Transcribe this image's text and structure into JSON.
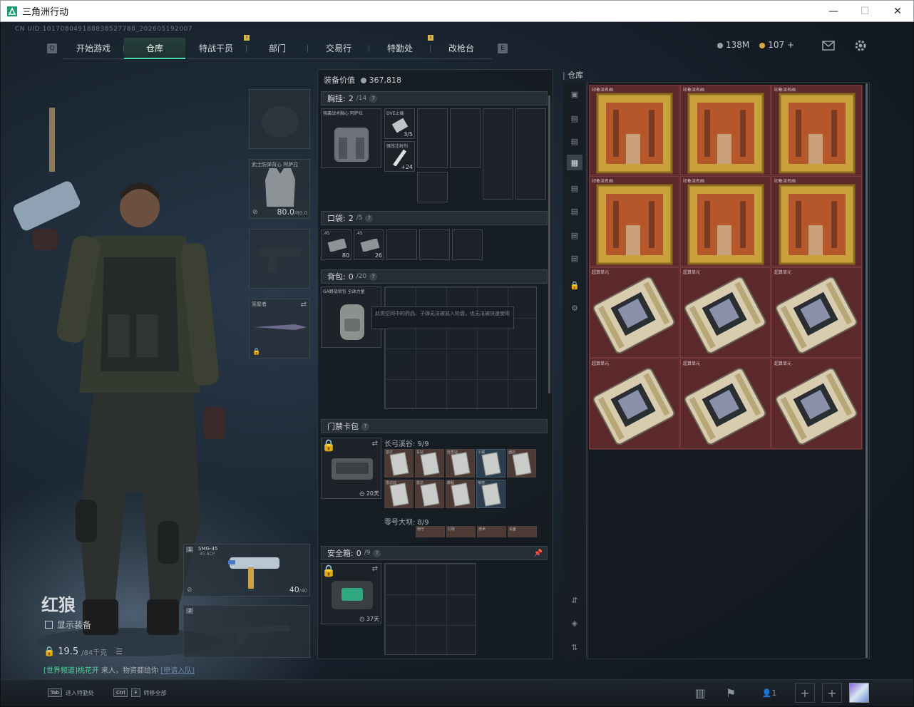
{
  "window": {
    "title": "三角洲行动",
    "minimize_icon": "—",
    "maximize_icon": "☐",
    "close_icon": "✕"
  },
  "uid": "CN UID:1017080491888385277​88_202605192007",
  "nav": {
    "tabs": [
      {
        "label": "开始游戏"
      },
      {
        "label": "仓库",
        "active": true
      },
      {
        "label": "特战干员",
        "badge": "!"
      },
      {
        "label": "部门"
      },
      {
        "label": "交易行"
      },
      {
        "label": "特勤处",
        "badge": "!"
      },
      {
        "label": "改枪台"
      }
    ],
    "left_key": "Q",
    "right_key": "E"
  },
  "currency": {
    "hafcoin": "138M",
    "tickets": "107",
    "plus": "+"
  },
  "operator": {
    "name": "红狼",
    "show_equip": "显示装备",
    "weight": "19.5",
    "weight_max": "/84千克",
    "team_prefix": "[世界频道]桃花开",
    "team_mid": " 来人，物资都给你",
    "team_link": "[申请入队]"
  },
  "equip": {
    "armor_name": "武士防弹背心 阿萨拉",
    "armor_value": "80.0",
    "armor_max": "/80.0",
    "melee_name": "笼屋者",
    "primary_index": "1",
    "primary_name": "SMG-45",
    "primary_ammo": ".45 ACP",
    "primary_mag": "40",
    "primary_mag_max": "/40",
    "secondary_index": "2"
  },
  "inventory": {
    "equip_value_label": "装备价值",
    "equip_value": "367,818",
    "chest_label": "胸挂:",
    "chest_count": "2",
    "chest_max": "/14",
    "chest_rig_name": "强袭战术胸心 阿萨拉",
    "chest_item1_name": "DVE止痛",
    "chest_item1_val": "3/5",
    "chest_item2_name": "强效注射剂",
    "chest_item2_val": "+24",
    "pocket_label": "口袋:",
    "pocket_count": "2",
    "pocket_max": "/5",
    "pocket_item1_name": ".45",
    "pocket_item1_val": "80",
    "pocket_item2_name": ".45",
    "pocket_item2_val": "26",
    "backpack_label": "背包:",
    "backpack_count": "0",
    "backpack_max": "/20",
    "backpack_name": "GA野战背包 全球力量",
    "tooltip": "此类空间中的药品、子弹无法被放入轮盘，也无法被快速使用",
    "keycard_label": "门禁卡包",
    "keycard_days": "20天",
    "map1_label": "长弓溪谷: 9/9",
    "map1_cards": [
      "雷达",
      "车站",
      "检查站",
      "小镇",
      "酒店",
      "雷达站",
      "雷达",
      "教程",
      "哨塔"
    ],
    "map2_label": "零号大坝: 8/9",
    "map2_cards": [
      "南厅",
      "行政",
      "技术",
      "设备"
    ],
    "safe_label": "安全箱:",
    "safe_count": "0",
    "safe_max": "/9",
    "safe_days": "37天"
  },
  "stash": {
    "label": "仓库",
    "items": [
      {
        "name": "印象派名画"
      },
      {
        "name": "印象派名画"
      },
      {
        "name": "印象派名画"
      },
      {
        "name": "印象派名画"
      },
      {
        "name": "印象派名画"
      },
      {
        "name": "印象派名画"
      },
      {
        "name": "超算单元"
      },
      {
        "name": "超算单元"
      },
      {
        "name": "超算单元"
      },
      {
        "name": "超算单元"
      },
      {
        "name": "超算单元"
      },
      {
        "name": "超算单元"
      }
    ]
  },
  "bottom": {
    "hint1_key": "Tab",
    "hint1": "进入特勤处",
    "hint2_key1": "Ctrl",
    "hint2_key2": "F",
    "hint2": "转移全部",
    "team_count": "1",
    "add": "+"
  },
  "colors": {
    "accent": "#3fe0a7",
    "badge": "#d9b648",
    "stash_bg": "#5c2a2e",
    "team_text": "#4fd69b"
  }
}
